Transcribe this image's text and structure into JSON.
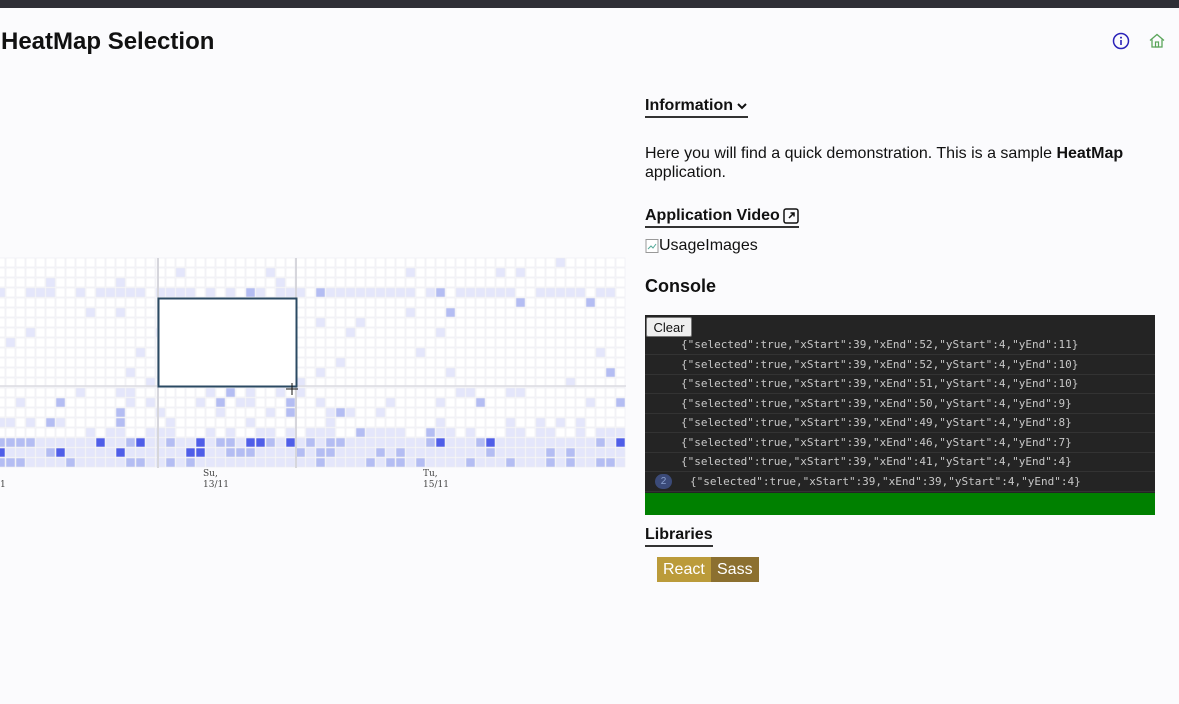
{
  "page": {
    "title": "HeatMap Selection"
  },
  "header": {
    "info_icon": "info-circle-icon",
    "home_icon": "home-icon"
  },
  "heatmap": {
    "x_tick_labels": [
      {
        "day": "",
        "date": "1"
      },
      {
        "day": "Su,",
        "date": "13/11"
      },
      {
        "day": "Tu,",
        "date": "15/11"
      }
    ],
    "selection": {
      "xStart": 39,
      "xEnd": 52,
      "yStart": 4,
      "yEnd": 11
    },
    "colors": {
      "cell_empty": "#ffffff",
      "cell_light": "#e4e6fb",
      "cell_mid": "#b4bdf3",
      "cell_dark": "#4f5ee8",
      "selection_border": "#2b4a63"
    }
  },
  "sidebar": {
    "information": {
      "label": "Information",
      "chevron_icon": "chevron-down-icon"
    },
    "description": {
      "before": "Here you will find a quick demonstration. This is a sample ",
      "bold": "HeatMap",
      "after": " application."
    },
    "video": {
      "label": "Application Video",
      "icon": "external-link-icon"
    },
    "usage_image_alt": "UsageImages",
    "console": {
      "title": "Console",
      "clear_label": "Clear",
      "lines": [
        "{\"selected\":true,\"xStart\":39,\"xEnd\":52,\"yStart\":4,\"yEnd\":11}",
        "{\"selected\":true,\"xStart\":39,\"xEnd\":52,\"yStart\":4,\"yEnd\":10}",
        "{\"selected\":true,\"xStart\":39,\"xEnd\":51,\"yStart\":4,\"yEnd\":10}",
        "{\"selected\":true,\"xStart\":39,\"xEnd\":50,\"yStart\":4,\"yEnd\":9}",
        "{\"selected\":true,\"xStart\":39,\"xEnd\":49,\"yStart\":4,\"yEnd\":8}",
        "{\"selected\":true,\"xStart\":39,\"xEnd\":46,\"yStart\":4,\"yEnd\":7}",
        "{\"selected\":true,\"xStart\":39,\"xEnd\":41,\"yStart\":4,\"yEnd\":4}"
      ],
      "last_line": {
        "count": "2",
        "text": "{\"selected\":true,\"xStart\":39,\"xEnd\":39,\"yStart\":4,\"yEnd\":4}"
      },
      "input_color": "#008000"
    },
    "libraries": {
      "label": "Libraries",
      "items": [
        {
          "name": "React",
          "color": "#bb9b3a"
        },
        {
          "name": "Sass",
          "color": "#8c7030"
        }
      ]
    }
  }
}
